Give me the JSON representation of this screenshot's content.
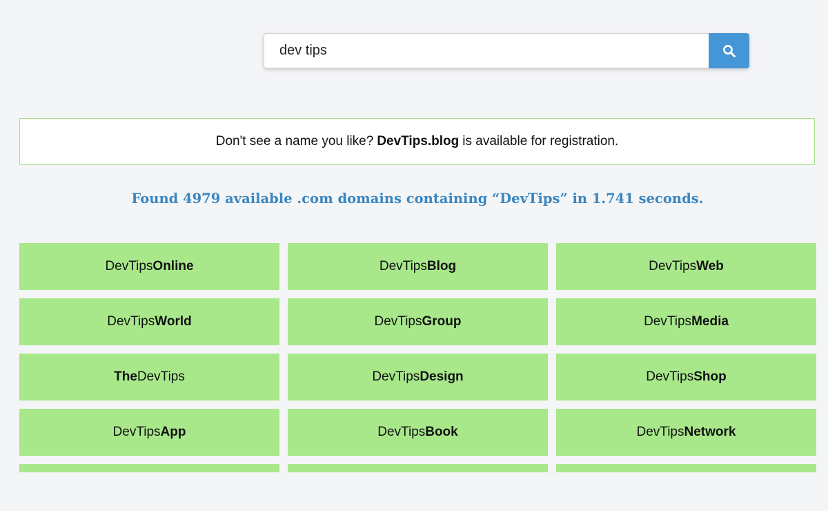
{
  "search": {
    "value": "dev tips",
    "button_icon": "search-icon",
    "button_color": "#4596d6"
  },
  "notice": {
    "prefix": "Don't see a name you like?",
    "domain": "DevTips.blog",
    "suffix": "is available for registration.",
    "border_color": "#a7e08b"
  },
  "results": {
    "summary": "Found 4979 available .com domains containing “DevTips” in 1.741 seconds.",
    "summary_color": "#3a86c0",
    "tile_color": "#a8e88b",
    "tiles": [
      {
        "prefix": "DevTips",
        "bold": "Online",
        "suffix": ""
      },
      {
        "prefix": "DevTips",
        "bold": "Blog",
        "suffix": ""
      },
      {
        "prefix": "DevTips",
        "bold": "Web",
        "suffix": ""
      },
      {
        "prefix": "DevTips",
        "bold": "World",
        "suffix": ""
      },
      {
        "prefix": "DevTips",
        "bold": "Group",
        "suffix": ""
      },
      {
        "prefix": "DevTips",
        "bold": "Media",
        "suffix": ""
      },
      {
        "prefix": "",
        "bold": "The",
        "suffix": "DevTips"
      },
      {
        "prefix": "DevTips",
        "bold": "Design",
        "suffix": ""
      },
      {
        "prefix": "DevTips",
        "bold": "Shop",
        "suffix": ""
      },
      {
        "prefix": "DevTips",
        "bold": "App",
        "suffix": ""
      },
      {
        "prefix": "DevTips",
        "bold": "Book",
        "suffix": ""
      },
      {
        "prefix": "DevTips",
        "bold": "Network",
        "suffix": ""
      }
    ]
  }
}
